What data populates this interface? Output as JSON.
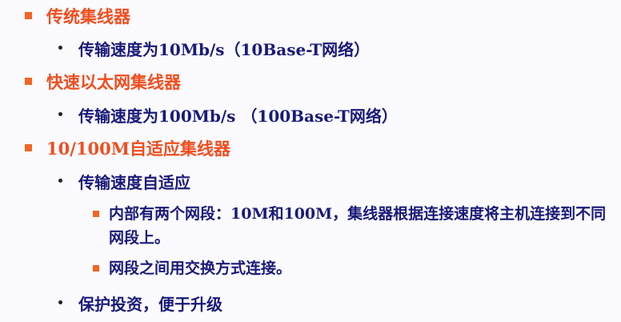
{
  "outline": {
    "item1": {
      "text": "传统集线器",
      "sub1": "传输速度为10Mb/s（10Base-T网络）"
    },
    "item2": {
      "text": "快速以太网集线器",
      "sub1": "传输速度为100Mb/s （100Base-T网络）"
    },
    "item3": {
      "text": "10/100M自适应集线器",
      "sub1": "传输速度自适应",
      "sub1_details": [
        "内部有两个网段：10M和100M，集线器根据连接速度将主机连接到不同网段上。",
        "网段之间用交换方式连接。"
      ],
      "sub2": "保护投资，便于升级"
    }
  },
  "colors": {
    "level1_text": "#f04e1e",
    "level2_text": "#1a1a78",
    "bullet_square": "#f26522",
    "bullet_dot": "#222222",
    "background": "#fafaff"
  },
  "icons": {
    "level1_bullet": "orange-square-bullet",
    "level2_bullet": "dark-dot-bullet",
    "level3_bullet": "orange-square-bullet"
  }
}
